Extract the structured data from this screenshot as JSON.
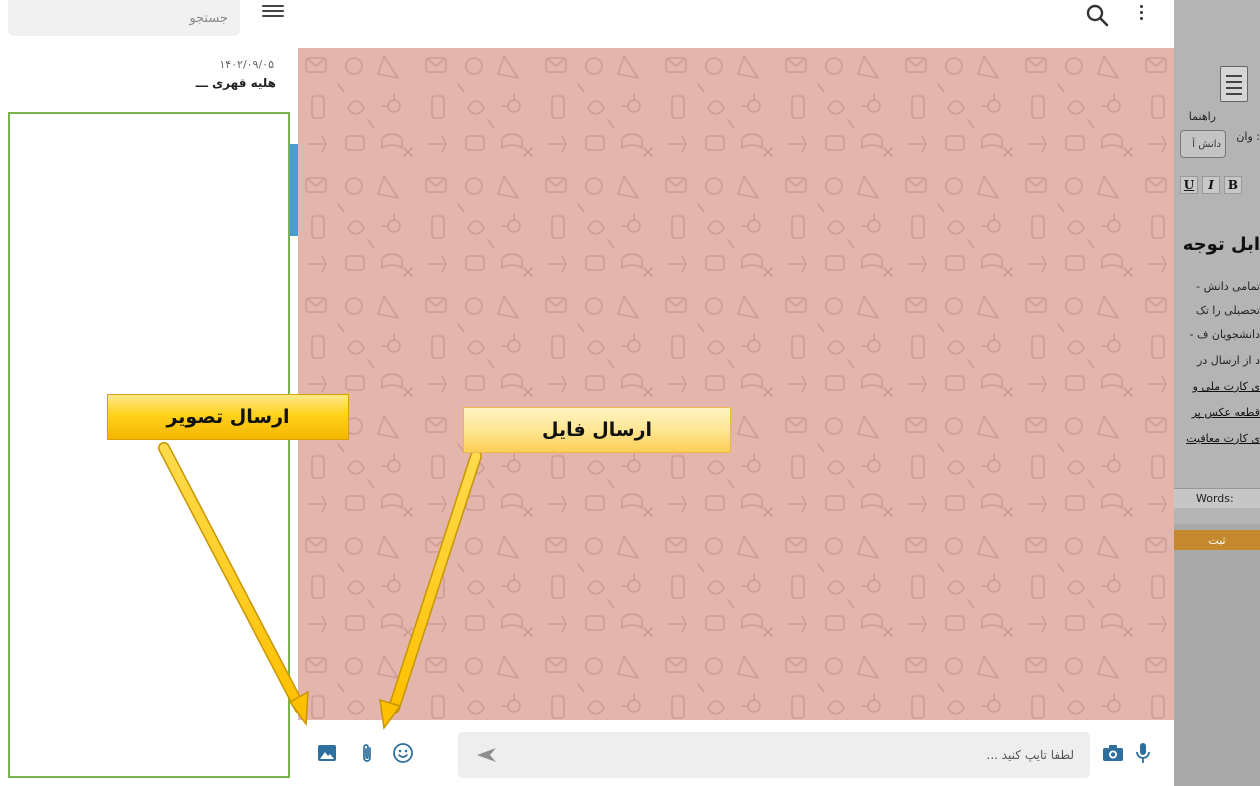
{
  "sidebar": {
    "search_placeholder": "جستجو",
    "contact": {
      "date": "۱۴۰۲/۰۹/۰۵",
      "name": "هلیه قهری ـــ"
    }
  },
  "chat": {
    "input_placeholder": "لطفا تایپ کنید ...",
    "background_color": "#e3b5ad",
    "pattern_color": "#c9918a"
  },
  "background_page": {
    "guide_label": "راهنما",
    "field_label": "وان :",
    "field_value": "دانش آ",
    "toolbar_bold": "B",
    "toolbar_italic": "I",
    "toolbar_underline": "U",
    "heading": "ابل توجه",
    "lines": [
      "- تمامی دانش",
      "تحصیلی را تک",
      "- دانشجویان ف",
      "د از ارسال در",
      "ی کارت ملی و",
      "قطعه عکس پر",
      "ی کارت معافیت"
    ],
    "words_label": "Words:",
    "submit_label": "ثبت"
  },
  "annotations": {
    "send_image": "ارسال تصویر",
    "send_file": "ارسال فایل",
    "arrow_color": "#ffc400"
  }
}
